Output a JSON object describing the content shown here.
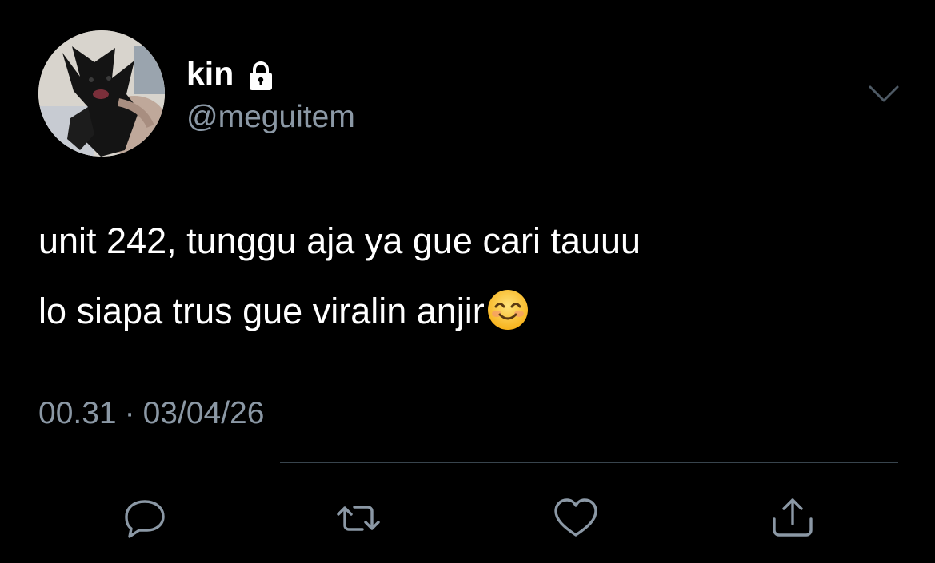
{
  "tweet": {
    "author": {
      "display_name": "kin",
      "handle": "@meguitem",
      "avatar_icon": "cat-avatar",
      "protected_icon": "lock-icon"
    },
    "text_lines": [
      "unit 242, tunggu aja ya gue cari tauuu",
      "lo siapa trus gue viralin anjir"
    ],
    "emoji": "smiling-face-with-smiling-eyes",
    "time": "00.31",
    "separator": "·",
    "date": "03/04/26",
    "menu_icon": "chevron-down-icon",
    "actions": [
      {
        "name": "reply",
        "icon": "speech-bubble-icon"
      },
      {
        "name": "retweet",
        "icon": "retweet-icon"
      },
      {
        "name": "like",
        "icon": "heart-icon"
      },
      {
        "name": "share",
        "icon": "share-icon"
      }
    ]
  },
  "colors": {
    "background": "#000000",
    "primary_text": "#ffffff",
    "secondary_text": "#8b98a5",
    "divider": "#38444d"
  }
}
